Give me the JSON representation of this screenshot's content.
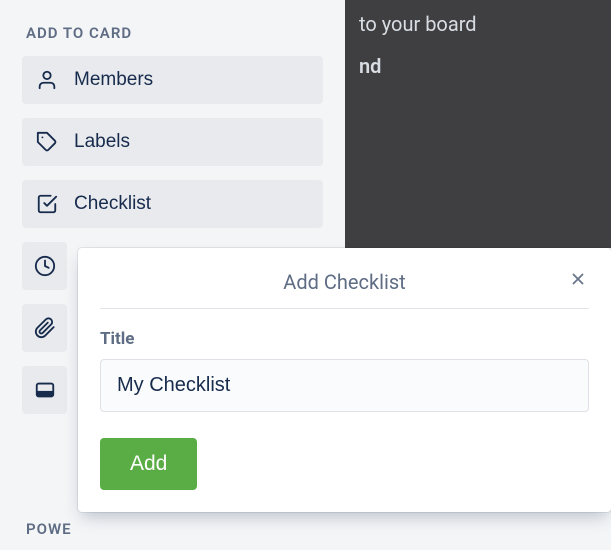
{
  "sidebar": {
    "heading": "ADD TO CARD",
    "items": [
      {
        "label": "Members",
        "icon": "person-icon"
      },
      {
        "label": "Labels",
        "icon": "tag-icon"
      },
      {
        "label": "Checklist",
        "icon": "checkbox-icon"
      },
      {
        "label": "",
        "icon": "clock-icon"
      },
      {
        "label": "",
        "icon": "attachment-icon"
      },
      {
        "label": "",
        "icon": "cover-icon"
      }
    ],
    "powerups_heading": "POWE"
  },
  "backdrop": {
    "line1": "to your board",
    "line2": "nd"
  },
  "popover": {
    "title": "Add Checklist",
    "title_field_label": "Title",
    "title_field_value": "My Checklist",
    "submit_label": "Add"
  }
}
